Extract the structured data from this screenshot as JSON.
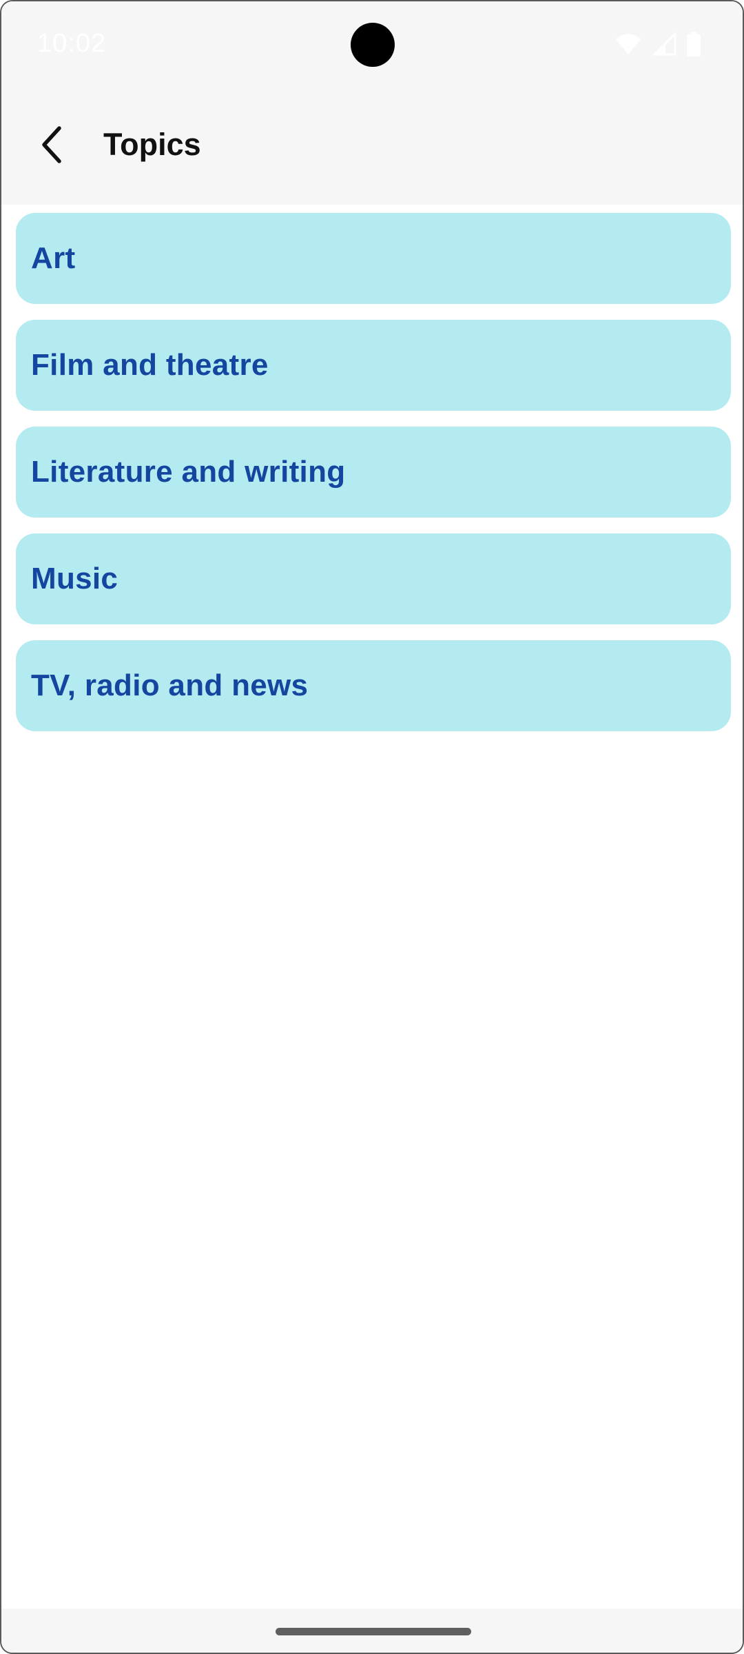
{
  "status_bar": {
    "time": "10:02",
    "icons": [
      "wifi-icon",
      "signal-icon",
      "battery-icon"
    ]
  },
  "app_bar": {
    "back_icon": "chevron-left-icon",
    "title": "Topics"
  },
  "topics": [
    {
      "label": "Art"
    },
    {
      "label": "Film and theatre"
    },
    {
      "label": "Literature and writing"
    },
    {
      "label": "Music"
    },
    {
      "label": "TV, radio and news"
    }
  ],
  "colors": {
    "topic_background": "#b3ebf1",
    "topic_text": "#1446a0",
    "bar_background": "#f6f6f6"
  }
}
